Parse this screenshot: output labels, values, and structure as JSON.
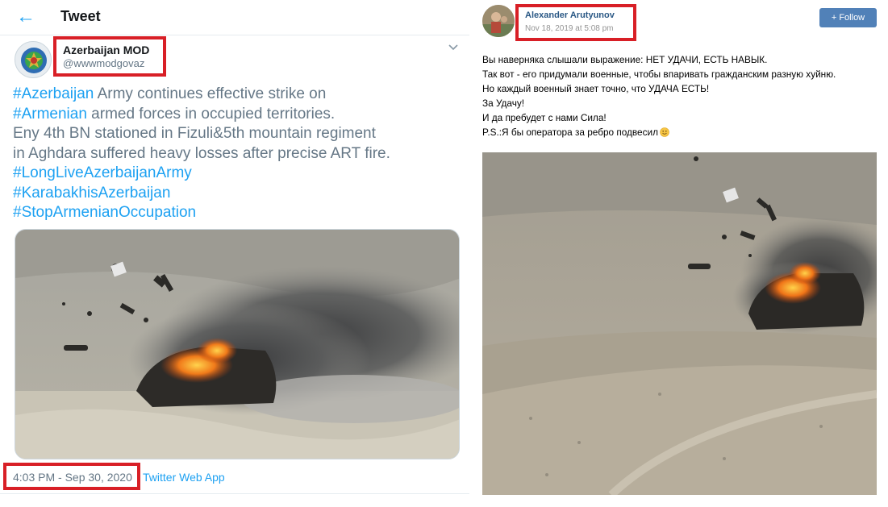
{
  "tweet": {
    "header_title": "Tweet",
    "author": {
      "name": "Azerbaijan MOD",
      "handle": "@wwwmodgovaz"
    },
    "text_lines": [
      {
        "parts": [
          {
            "text": "#Azerbaijan",
            "hashtag": true
          },
          {
            "text": " Army continues effective strike on",
            "hashtag": false
          }
        ]
      },
      {
        "parts": [
          {
            "text": "#Armenian",
            "hashtag": true
          },
          {
            "text": " armed forces in occupied territories.",
            "hashtag": false
          }
        ]
      },
      {
        "parts": [
          {
            "text": "Eny 4th BN stationed in Fizuli&5th mountain regiment",
            "hashtag": false
          }
        ]
      },
      {
        "parts": [
          {
            "text": "in Aghdara suffered heavy losses after precise ART fire.",
            "hashtag": false
          }
        ]
      },
      {
        "parts": [
          {
            "text": "#LongLiveAzerbaijanArmy",
            "hashtag": true
          }
        ]
      },
      {
        "parts": [
          {
            "text": "#KarabakhisAzerbaijan",
            "hashtag": true
          }
        ]
      },
      {
        "parts": [
          {
            "text": "#StopArmenianOccupation",
            "hashtag": true
          }
        ]
      }
    ],
    "timestamp": "4:03 PM - Sep 30, 2020",
    "source": "Twitter Web App",
    "icons": {
      "back": "back-arrow-icon",
      "caret": "chevron-down-icon"
    },
    "colors": {
      "accent": "#1da1f2",
      "highlight_box": "#d81f26"
    }
  },
  "vk_post": {
    "author": "Alexander Arutyunov",
    "date": "Nov 18, 2019 at 5:08 pm",
    "follow_label": "+ Follow",
    "text_lines": [
      "Вы наверняка слышали выражение: НЕТ УДАЧИ, ЕСТЬ НАВЫК.",
      "Так вот - его придумали военные, чтобы впаривать гражданским разную хуйню.",
      "Но каждый военный знает точно, что УДАЧА ЕСТЬ!",
      "За Удачу!",
      "И да пребудет с нами Сила!",
      "P.S.:Я бы оператора за ребро подвесил"
    ],
    "icons": {
      "emoji": "smile-icon"
    },
    "colors": {
      "link": "#2a5885",
      "button": "#5181b8"
    }
  }
}
